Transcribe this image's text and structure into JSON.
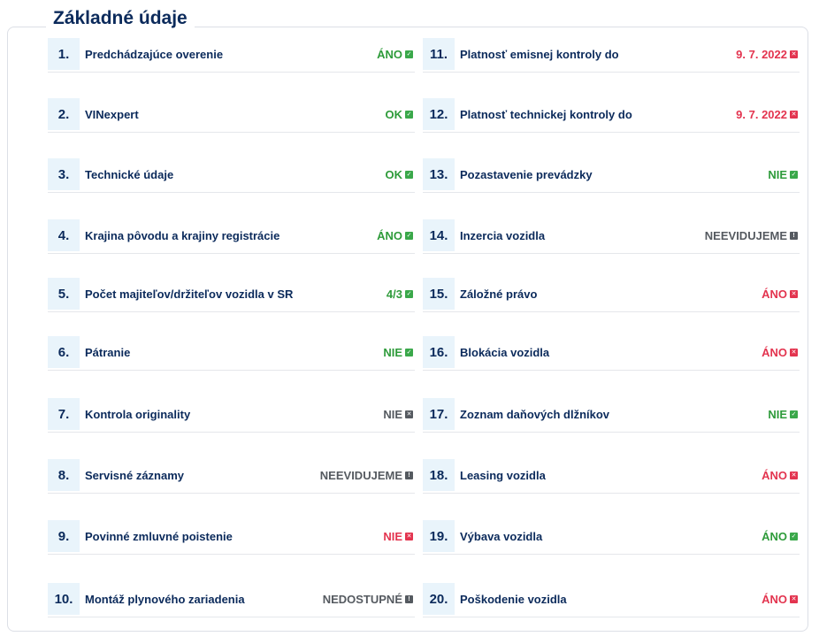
{
  "section_title": "Základné údaje",
  "colors": {
    "ok": "#2e9b3a",
    "bad": "#e3344f",
    "neutral": "#555a60",
    "title": "#0b2a5b",
    "badge_bg": "#e9f4fb"
  },
  "left_items": [
    {
      "num": "1.",
      "label": "Predchádzajúce overenie",
      "status": "ÁNO",
      "kind": "ok",
      "icon": "check-icon"
    },
    {
      "num": "2.",
      "label": "VINexpert",
      "status": "OK",
      "kind": "ok",
      "icon": "check-icon"
    },
    {
      "num": "3.",
      "label": "Technické údaje",
      "status": "OK",
      "kind": "ok",
      "icon": "check-icon"
    },
    {
      "num": "4.",
      "label": "Krajina pôvodu a krajiny registrácie",
      "status": "ÁNO",
      "kind": "ok",
      "icon": "check-icon"
    },
    {
      "num": "5.",
      "label": "Počet majiteľov/držiteľov vozidla v SR",
      "status": "4/3",
      "kind": "ok",
      "icon": "check-icon"
    },
    {
      "num": "6.",
      "label": "Pátranie",
      "status": "NIE",
      "kind": "ok",
      "icon": "check-icon"
    },
    {
      "num": "7.",
      "label": "Kontrola originality",
      "status": "NIE",
      "kind": "na",
      "icon": "cross-icon"
    },
    {
      "num": "8.",
      "label": "Servisné záznamy",
      "status": "NEEVIDUJEME",
      "kind": "na",
      "icon": "info-icon"
    },
    {
      "num": "9.",
      "label": "Povinné zmluvné poistenie",
      "status": "NIE",
      "kind": "bad",
      "icon": "cross-icon"
    },
    {
      "num": "10.",
      "label": "Montáž plynového zariadenia",
      "status": "NEDOSTUPNÉ",
      "kind": "na",
      "icon": "info-icon"
    }
  ],
  "right_items": [
    {
      "num": "11.",
      "label": "Platnosť emisnej kontroly do",
      "status": "9. 7. 2022",
      "kind": "bad",
      "icon": "cross-icon"
    },
    {
      "num": "12.",
      "label": "Platnosť technickej kontroly do",
      "status": "9. 7. 2022",
      "kind": "bad",
      "icon": "cross-icon"
    },
    {
      "num": "13.",
      "label": "Pozastavenie prevádzky",
      "status": "NIE",
      "kind": "ok",
      "icon": "check-icon"
    },
    {
      "num": "14.",
      "label": "Inzercia vozidla",
      "status": "NEEVIDUJEME",
      "kind": "na",
      "icon": "info-icon"
    },
    {
      "num": "15.",
      "label": "Záložné právo",
      "status": "ÁNO",
      "kind": "bad",
      "icon": "cross-icon"
    },
    {
      "num": "16.",
      "label": "Blokácia vozidla",
      "status": "ÁNO",
      "kind": "bad",
      "icon": "cross-icon"
    },
    {
      "num": "17.",
      "label": "Zoznam daňových dlžníkov",
      "status": "NIE",
      "kind": "ok",
      "icon": "check-icon"
    },
    {
      "num": "18.",
      "label": "Leasing vozidla",
      "status": "ÁNO",
      "kind": "bad",
      "icon": "cross-icon"
    },
    {
      "num": "19.",
      "label": "Výbava vozidla",
      "status": "ÁNO",
      "kind": "ok",
      "icon": "check-icon"
    },
    {
      "num": "20.",
      "label": "Poškodenie vozidla",
      "status": "ÁNO",
      "kind": "bad",
      "icon": "cross-icon"
    }
  ]
}
